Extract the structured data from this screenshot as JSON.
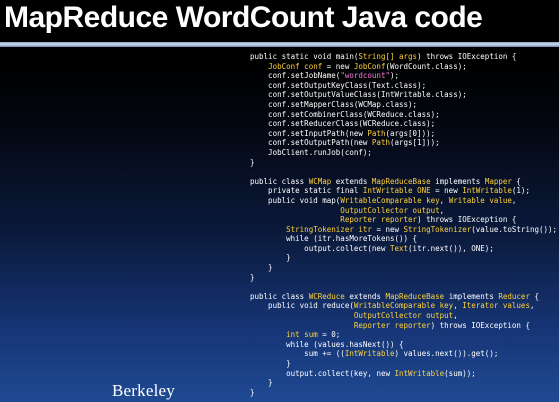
{
  "slide": {
    "title": "MapReduce WordCount Java code"
  },
  "logo": {
    "text": "Berkeley"
  },
  "colors": {
    "code_keyword": "#ffffff",
    "code_type": "#ffd23a",
    "code_string": "#ff7be0",
    "code_plain": "#ffffff",
    "title_text": "#ffffff",
    "background_bottom": "#1f4a93"
  },
  "code": {
    "lines": [
      [
        [
          "k",
          "public static void "
        ],
        [
          "p",
          "main("
        ],
        [
          "t",
          "String[] args"
        ],
        [
          "p",
          ") "
        ],
        [
          "k",
          "throws "
        ],
        [
          "p",
          "IOException {"
        ]
      ],
      [
        [
          "p",
          "    "
        ],
        [
          "t",
          "JobConf conf "
        ],
        [
          "p",
          "= "
        ],
        [
          "k",
          "new "
        ],
        [
          "t",
          "JobConf"
        ],
        [
          "p",
          "(WordCount."
        ],
        [
          "k",
          "class"
        ],
        [
          "p",
          ");"
        ]
      ],
      [
        [
          "p",
          "    conf.setJobName("
        ],
        [
          "s",
          "\"wordcount\""
        ],
        [
          "p",
          ");"
        ]
      ],
      [
        [
          "p",
          "    conf.setOutputKeyClass(Text."
        ],
        [
          "k",
          "class"
        ],
        [
          "p",
          ");"
        ]
      ],
      [
        [
          "p",
          "    conf.setOutputValueClass(IntWritable."
        ],
        [
          "k",
          "class"
        ],
        [
          "p",
          ");"
        ]
      ],
      [
        [
          "p",
          "    conf.setMapperClass(WCMap."
        ],
        [
          "k",
          "class"
        ],
        [
          "p",
          ");"
        ]
      ],
      [
        [
          "p",
          "    conf.setCombinerClass(WCReduce."
        ],
        [
          "k",
          "class"
        ],
        [
          "p",
          ");"
        ]
      ],
      [
        [
          "p",
          "    conf.setReducerClass(WCReduce."
        ],
        [
          "k",
          "class"
        ],
        [
          "p",
          ");"
        ]
      ],
      [
        [
          "p",
          "    conf.setInputPath("
        ],
        [
          "k",
          "new "
        ],
        [
          "t",
          "Path"
        ],
        [
          "p",
          "(args[0]));"
        ]
      ],
      [
        [
          "p",
          "    conf.setOutputPath("
        ],
        [
          "k",
          "new "
        ],
        [
          "t",
          "Path"
        ],
        [
          "p",
          "(args[1]));"
        ]
      ],
      [
        [
          "p",
          "    JobClient.runJob(conf);"
        ]
      ],
      [
        [
          "p",
          "}"
        ]
      ],
      [
        [
          "p",
          ""
        ]
      ],
      [
        [
          "k",
          "public class "
        ],
        [
          "t",
          "WCMap "
        ],
        [
          "k",
          "extends "
        ],
        [
          "t",
          "MapReduceBase "
        ],
        [
          "k",
          "implements "
        ],
        [
          "t",
          "Mapper "
        ],
        [
          "p",
          "{"
        ]
      ],
      [
        [
          "k",
          "    private static final "
        ],
        [
          "t",
          "IntWritable ONE "
        ],
        [
          "p",
          "= "
        ],
        [
          "k",
          "new "
        ],
        [
          "t",
          "IntWritable"
        ],
        [
          "p",
          "(1);"
        ]
      ],
      [
        [
          "k",
          "    public void "
        ],
        [
          "p",
          "map("
        ],
        [
          "t",
          "WritableComparable key"
        ],
        [
          "p",
          ", "
        ],
        [
          "t",
          "Writable value"
        ],
        [
          "p",
          ","
        ]
      ],
      [
        [
          "t",
          "                    OutputCollector output"
        ],
        [
          "p",
          ","
        ]
      ],
      [
        [
          "t",
          "                    Reporter reporter"
        ],
        [
          "p",
          ") "
        ],
        [
          "k",
          "throws "
        ],
        [
          "p",
          "IOException {"
        ]
      ],
      [
        [
          "p",
          "        "
        ],
        [
          "t",
          "StringTokenizer itr "
        ],
        [
          "p",
          "= "
        ],
        [
          "k",
          "new "
        ],
        [
          "t",
          "StringTokenizer"
        ],
        [
          "p",
          "(value.toString());"
        ]
      ],
      [
        [
          "k",
          "        while "
        ],
        [
          "p",
          "(itr.hasMoreTokens()) {"
        ]
      ],
      [
        [
          "p",
          "            output.collect("
        ],
        [
          "k",
          "new "
        ],
        [
          "t",
          "Text"
        ],
        [
          "p",
          "(itr.next()), ONE);"
        ]
      ],
      [
        [
          "p",
          "        }"
        ]
      ],
      [
        [
          "p",
          "    }"
        ]
      ],
      [
        [
          "p",
          "}"
        ]
      ],
      [
        [
          "p",
          ""
        ]
      ],
      [
        [
          "k",
          "public class "
        ],
        [
          "t",
          "WCReduce "
        ],
        [
          "k",
          "extends "
        ],
        [
          "t",
          "MapReduceBase "
        ],
        [
          "k",
          "implements "
        ],
        [
          "t",
          "Reducer "
        ],
        [
          "p",
          "{"
        ]
      ],
      [
        [
          "k",
          "    public void "
        ],
        [
          "p",
          "reduce("
        ],
        [
          "t",
          "WritableComparable key"
        ],
        [
          "p",
          ", "
        ],
        [
          "t",
          "Iterator values"
        ],
        [
          "p",
          ","
        ]
      ],
      [
        [
          "t",
          "                       OutputCollector output"
        ],
        [
          "p",
          ","
        ]
      ],
      [
        [
          "t",
          "                       Reporter reporter"
        ],
        [
          "p",
          ") "
        ],
        [
          "k",
          "throws "
        ],
        [
          "p",
          "IOException {"
        ]
      ],
      [
        [
          "t",
          "        int sum "
        ],
        [
          "p",
          "= 0;"
        ]
      ],
      [
        [
          "k",
          "        while "
        ],
        [
          "p",
          "(values.hasNext()) {"
        ]
      ],
      [
        [
          "p",
          "            sum += (("
        ],
        [
          "t",
          "IntWritable"
        ],
        [
          "p",
          ") values.next()).get();"
        ]
      ],
      [
        [
          "p",
          "        }"
        ]
      ],
      [
        [
          "p",
          "        output.collect(key, "
        ],
        [
          "k",
          "new "
        ],
        [
          "t",
          "IntWritable"
        ],
        [
          "p",
          "(sum));"
        ]
      ],
      [
        [
          "p",
          "    }"
        ]
      ],
      [
        [
          "p",
          "}"
        ]
      ]
    ]
  }
}
